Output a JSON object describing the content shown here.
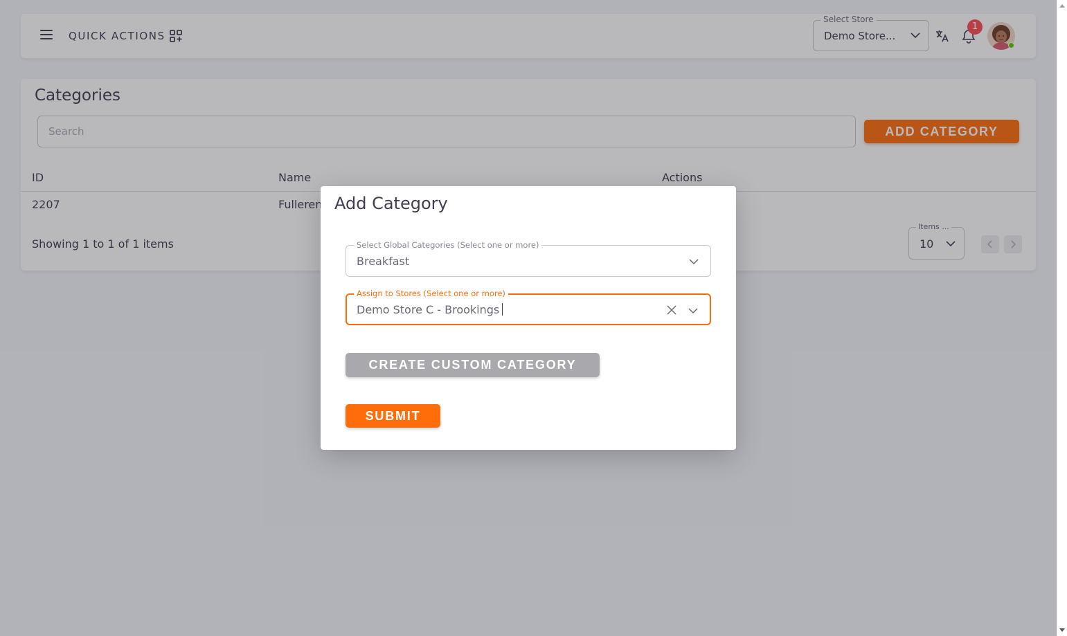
{
  "appbar": {
    "quick_actions_label": "QUICK ACTIONS",
    "store_select": {
      "legend": "Select Store",
      "value": "Demo Store..."
    },
    "notification_count": "1"
  },
  "categories": {
    "title": "Categories",
    "search_placeholder": "Search",
    "add_button_label": "ADD CATEGORY",
    "columns": {
      "id": "ID",
      "name": "Name",
      "actions": "Actions"
    },
    "rows": [
      {
        "id": "2207",
        "name": "Fulleren"
      }
    ],
    "showing_text": "Showing 1 to 1 of 1 items",
    "items_per_page": {
      "legend": "Items ...",
      "value": "10"
    }
  },
  "modal": {
    "title": "Add Category",
    "global_categories": {
      "legend": "Select Global Categories (Select one or more)",
      "value": "Breakfast"
    },
    "assign_stores": {
      "legend": "Assign to Stores (Select one or more)",
      "value": "Demo Store C - Brookings"
    },
    "create_custom_label": "CREATE CUSTOM CATEGORY",
    "submit_label": "SUBMIT"
  },
  "colors": {
    "accent": "#ff6c0a",
    "badge": "#ff4c51",
    "online": "#56ca00",
    "disabled_button": "#a9a9ad"
  },
  "icons": [
    "menu-icon",
    "quick-actions-icon",
    "chevron-down-icon",
    "translate-icon",
    "bell-icon",
    "close-icon",
    "chevron-left-icon",
    "chevron-right-icon"
  ]
}
